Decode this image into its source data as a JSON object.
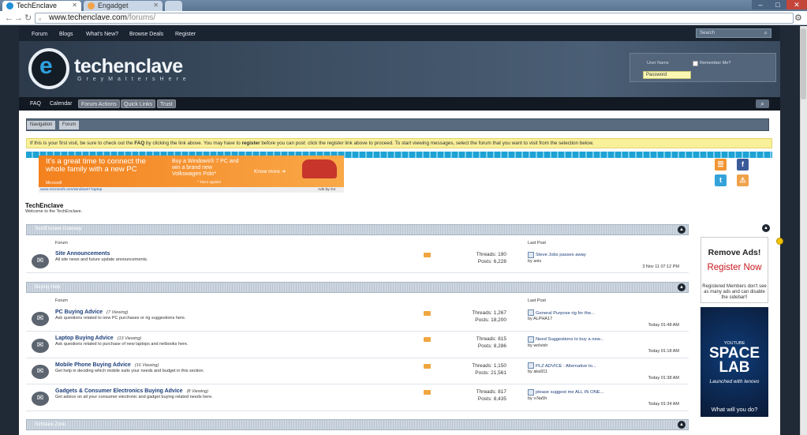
{
  "browser": {
    "tabs": [
      {
        "title": "TechEnclave",
        "active": true,
        "icon": "techenclave-favicon"
      },
      {
        "title": "Engadget",
        "active": false,
        "icon": "rss-favicon"
      }
    ],
    "url_host": "www.techenclave.com",
    "url_path": "/forums/",
    "window_buttons": [
      "–",
      "□",
      "✕"
    ]
  },
  "topnav": {
    "items": [
      "Forum",
      "Blogs",
      "What's New?",
      "Browse Deals",
      "Register"
    ],
    "search_placeholder": "Search"
  },
  "logo": {
    "text": "techenclave",
    "tagline": "GreyMattersHere"
  },
  "login": {
    "username_label": "User Name",
    "password_value": "Password",
    "remember_label": "Remember Me?"
  },
  "subnav": {
    "items": [
      "FAQ",
      "Calendar"
    ],
    "pills": [
      "Forum Actions",
      "Quick Links",
      "Trust"
    ]
  },
  "breadcrumb": [
    "Navigation",
    "Forum"
  ],
  "notice": {
    "pre": "If this is your first visit, be sure to check out the ",
    "faq": "FAQ",
    "mid": " by clicking the link above. You may have to ",
    "register": "register",
    "post": " before you can post: click the register link above to proceed. To start viewing messages, select the forum that you want to visit from the selection below."
  },
  "ad": {
    "headline": "It's a great time to connect the whole family with a new PC",
    "offer": "Buy a Windows® 7 PC and win a brand new Volkswagen Polo*",
    "tc": "* T&Cs applied",
    "cta": "Know more",
    "brand": "Microsoft",
    "footer_url": "www.microsoft.com/windows7-laptop",
    "footer_adsby": "Ads by Go"
  },
  "social": [
    "rss-icon",
    "facebook-icon",
    "twitter-icon",
    "alert-icon"
  ],
  "site": {
    "title": "TechEnclave",
    "welcome": "Welcome to the TechEnclave."
  },
  "categories": [
    {
      "name": "TechEnclave Gateway",
      "forum_header": "Forum",
      "lastpost_header": "Last Post",
      "forums": [
        {
          "title": "Site Announcements",
          "viewing": "",
          "desc": "All site news and future update announcements.",
          "threads": "Threads: 190",
          "posts": "Posts: 6,228",
          "lp_title": "Steve Jobs passes away",
          "lp_by": "by axis",
          "lp_date": "3 Nov 11 07:12 PM"
        }
      ]
    },
    {
      "name": "Buying Help",
      "forum_header": "Forum",
      "lastpost_header": "Last Post",
      "forums": [
        {
          "title": "PC Buying Advice",
          "viewing": "(7 Viewing)",
          "desc": "Ask questions related to new PC purchases or rig suggestions here.",
          "threads": "Threads: 1,267",
          "posts": "Posts: 18,200",
          "lp_title": "General Purpose rig for the...",
          "lp_by": "by ALPHA17",
          "lp_date": "Today 01:48 AM"
        },
        {
          "title": "Laptop Buying Advice",
          "viewing": "(13 Viewing)",
          "desc": "Ask questions related to purchase of new laptops and netbooks here.",
          "threads": "Threads: 815",
          "posts": "Posts: 8,286",
          "lp_title": "Need Suggestions to buy a new...",
          "lp_by": "by wolvish",
          "lp_date": "Today 01:18 AM"
        },
        {
          "title": "Mobile Phone Buying Advice",
          "viewing": "(16 Viewing)",
          "desc": "Get help in deciding which mobile suits your needs and budget in this section.",
          "threads": "Threads: 1,150",
          "posts": "Posts: 21,561",
          "lp_title": "PLZ ADVICE : Alternative to...",
          "lp_by": "by aka911",
          "lp_date": "Today 01:38 AM"
        },
        {
          "title": "Gadgets & Consumer Electronics Buying Advice",
          "viewing": "(8 Viewing)",
          "desc": "Get advice on all your consumer electronic and gadget buying related needs here.",
          "threads": "Threads: 817",
          "posts": "Posts: 8,435",
          "lp_title": "please suggest me ALL IN ONE...",
          "lp_by": "by v.Na5h",
          "lp_date": "Today 01:34 AM"
        }
      ]
    },
    {
      "name": "Software Zone",
      "forums": []
    }
  ],
  "sidebar_ad": {
    "title": "Remove Ads!",
    "cta": "Register Now",
    "desc": "Registered Members don't see as many ads and can disable the sidebar!!",
    "lab_brand": "YOUTUBE",
    "lab_title": "SPACE LAB",
    "lab_sub": "Launched with lenovo",
    "lab_q": "What will you do?"
  }
}
